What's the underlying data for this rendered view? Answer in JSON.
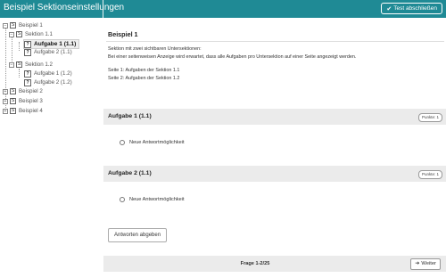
{
  "header": {
    "title": "Beispiel Sektionseinstellungen",
    "finish_button": "Test abschließen",
    "finish_icon": "check-circle-icon"
  },
  "tree": [
    {
      "label": "Beispiel 1",
      "icon": "S",
      "level": 0,
      "expanded": true
    },
    {
      "label": "Sektion 1.1",
      "icon": "S",
      "level": 1,
      "expanded": true
    },
    {
      "label": "Aufgabe 1 (1.1)",
      "icon": "?",
      "level": 2,
      "active": true
    },
    {
      "label": "Aufgabe 2 (1.1)",
      "icon": "?",
      "level": 2
    },
    {
      "label": "Sektion 1.2",
      "icon": "S",
      "level": 1,
      "expanded": true
    },
    {
      "label": "Aufgabe 1 (1.2)",
      "icon": "?",
      "level": 2
    },
    {
      "label": "Aufgabe 2 (1.2)",
      "icon": "?",
      "level": 2
    },
    {
      "label": "Beispiel 2",
      "icon": "S",
      "level": 0,
      "expanded": false
    },
    {
      "label": "Beispiel 3",
      "icon": "S",
      "level": 0,
      "expanded": false
    },
    {
      "label": "Beispiel 4",
      "icon": "S",
      "level": 0,
      "expanded": false
    }
  ],
  "section": {
    "title": "Beispiel 1",
    "lines": [
      "Sektion mit zwei sichtbaren Untersektionen:",
      "Bei einer seitenweisen Anzeige wird erwartet, dass alle Aufgaben pro Untersektion auf einer Seite angezeigt werden.",
      "Seite 1: Aufgaben der Sektion 1.1",
      "Seite 2: Aufgaben der Sektion 1.2"
    ]
  },
  "tasks": [
    {
      "title": "Aufgabe 1 (1.1)",
      "points": "Punkte: 1",
      "answer": "Neue Antwortmöglichkeit"
    },
    {
      "title": "Aufgabe 2 (1.1)",
      "points": "Punkte: 1",
      "answer": "Neue Antwortmöglichkeit"
    }
  ],
  "submit_button": "Antworten abgeben",
  "footer": {
    "pager": "Frage 1-2/25",
    "next_button": "Weiter",
    "next_icon": "arrow-right-circle-icon"
  },
  "colors": {
    "header_bg": "#1f8a95",
    "panel_bg": "#ebebeb"
  }
}
